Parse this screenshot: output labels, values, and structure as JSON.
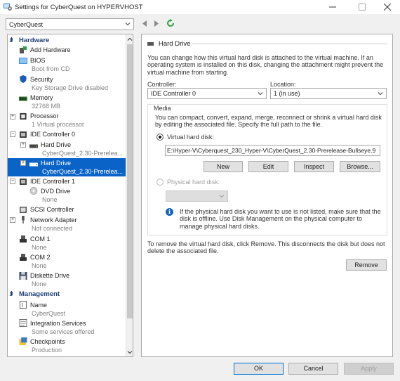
{
  "window": {
    "title": "Settings for CyberQuest on HYPERVHOST"
  },
  "toolbar": {
    "vm_selected": "CyberQuest"
  },
  "sidebar": {
    "hardware_label": "Hardware",
    "management_label": "Management",
    "items": [
      {
        "name": "Add Hardware",
        "sub": ""
      },
      {
        "name": "BIOS",
        "sub": "Boot from CD"
      },
      {
        "name": "Security",
        "sub": "Key Storage Drive disabled"
      },
      {
        "name": "Memory",
        "sub": "32768 MB"
      },
      {
        "name": "Processor",
        "sub": "1 Virtual processor"
      },
      {
        "name": "IDE Controller 0",
        "sub": ""
      },
      {
        "name": "Hard Drive",
        "sub": "CyberQuest_2.30-Prerelea..."
      },
      {
        "name": "Hard Drive",
        "sub": "CyberQuest_2.30-Prerelea..."
      },
      {
        "name": "IDE Controller 1",
        "sub": ""
      },
      {
        "name": "DVD Drive",
        "sub": "None"
      },
      {
        "name": "SCSI Controller",
        "sub": ""
      },
      {
        "name": "Network Adapter",
        "sub": "Not connected"
      },
      {
        "name": "COM 1",
        "sub": "None"
      },
      {
        "name": "COM 2",
        "sub": "None"
      },
      {
        "name": "Diskette Drive",
        "sub": "None"
      },
      {
        "name": "Name",
        "sub": "CyberQuest"
      },
      {
        "name": "Integration Services",
        "sub": "Some services offered"
      },
      {
        "name": "Checkpoints",
        "sub": "Production"
      }
    ]
  },
  "hard_drive": {
    "heading": "Hard Drive",
    "description": "You can change how this virtual hard disk is attached to the virtual machine. If an operating system is installed on this disk, changing the attachment might prevent the virtual machine from starting.",
    "controller_label": "Controller:",
    "controller_value": "IDE Controller 0",
    "location_label": "Location:",
    "location_value": "1 (in use)",
    "media_label": "Media",
    "media_description": "You can compact, convert, expand, merge, reconnect or shrink a virtual hard disk by editing the associated file. Specify the full path to the file.",
    "virtual_disk_label": "Virtual hard disk:",
    "virtual_disk_path": "E:\\Hyper-V\\Cyberquest_230_Hyper-V\\CyberQuest_2.30-Prerelease-Bullseye.9",
    "new_label": "New",
    "edit_label": "Edit",
    "inspect_label": "Inspect",
    "browse_label": "Browse...",
    "physical_disk_label": "Physical hard disk:",
    "info_text": "If the physical hard disk you want to use is not listed, make sure that the disk is offline. Use Disk Management on the physical computer to manage physical hard disks.",
    "remove_description": "To remove the virtual hard disk, click Remove. This disconnects the disk but does not delete the associated file.",
    "remove_label": "Remove"
  },
  "footer": {
    "ok_label": "OK",
    "cancel_label": "Cancel",
    "apply_label": "Apply"
  },
  "colors": {
    "selection": "#0a64c8",
    "section_header": "#1f3f78",
    "refresh_icon": "#2e9e3e",
    "info_icon": "#1565c0"
  }
}
